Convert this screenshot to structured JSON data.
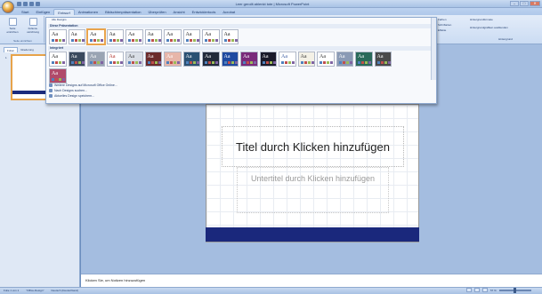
{
  "window": {
    "title": "Leer gerollt ablenkt tote | Microsoft PowerPoint",
    "controls": [
      "–",
      "□",
      "✕"
    ]
  },
  "quick_access": [
    "save-icon",
    "undo-icon",
    "redo-icon",
    "dropdown-icon"
  ],
  "tabs": [
    {
      "label": "Start",
      "active": false
    },
    {
      "label": "Einfügen",
      "active": false
    },
    {
      "label": "Entwurf",
      "active": true
    },
    {
      "label": "Animationen",
      "active": false
    },
    {
      "label": "Bildschirmpräsentation",
      "active": false
    },
    {
      "label": "Überprüfen",
      "active": false
    },
    {
      "label": "Ansicht",
      "active": false
    },
    {
      "label": "Entwicklertools",
      "active": false
    },
    {
      "label": "Acrobat",
      "active": false
    }
  ],
  "ribbon": {
    "page_setup_group": {
      "buttons": [
        "Seite einrichten",
        "Foliena­usrichtung"
      ],
      "label": "Seite einrichten"
    },
    "right_group": {
      "buttons": [
        "Farben",
        "Schriftarten",
        "Effekte"
      ],
      "bg_buttons": [
        "Hintergrundformate",
        "Hintergrundgrafiken ausblenden"
      ],
      "label": "Hintergrund"
    }
  },
  "gallery": {
    "top_button": "Alle Designs",
    "section_this": "Diese Präsentation",
    "section_builtin": "Integriert",
    "menu_items": [
      {
        "icon": "globe-icon",
        "label": "Weitere Designs auf Microsoft Office Online..."
      },
      {
        "icon": "folder-icon",
        "label": "Nach Designs suchen..."
      },
      {
        "icon": "save-icon",
        "label": "Aktuelles Design speichern..."
      }
    ],
    "row1": [
      {
        "name": "design-1",
        "bg": "#ffffff",
        "fg": "#222222",
        "selected": false
      },
      {
        "name": "design-2",
        "bg": "#ffffff",
        "fg": "#222222",
        "selected": false
      },
      {
        "name": "design-3",
        "bg": "#ffffff",
        "fg": "#222222",
        "selected": true
      },
      {
        "name": "design-4",
        "bg": "#ffffff",
        "fg": "#222222",
        "selected": false
      },
      {
        "name": "design-5",
        "bg": "#ffffff",
        "fg": "#222222",
        "selected": false
      },
      {
        "name": "design-6",
        "bg": "#ffffff",
        "fg": "#222222",
        "selected": false
      },
      {
        "name": "design-7",
        "bg": "#ffffff",
        "fg": "#222222",
        "selected": false
      },
      {
        "name": "design-8",
        "bg": "#ffffff",
        "fg": "#222222",
        "selected": false
      },
      {
        "name": "design-9",
        "bg": "#ffffff",
        "fg": "#222222",
        "selected": false
      },
      {
        "name": "design-10",
        "bg": "#ffffff",
        "fg": "#222222",
        "selected": false
      }
    ],
    "row2": [
      {
        "name": "builtin-1",
        "bg": "#ffffff",
        "fg": "#222222"
      },
      {
        "name": "builtin-2",
        "bg": "#3b4a5e",
        "fg": "#ffffff"
      },
      {
        "name": "builtin-3",
        "bg": "#9aa4b3",
        "fg": "#ffffff"
      },
      {
        "name": "builtin-4",
        "bg": "#ffffff",
        "fg": "#b0302a"
      },
      {
        "name": "builtin-5",
        "bg": "#d9dee6",
        "fg": "#333333"
      },
      {
        "name": "builtin-6",
        "bg": "#6b2b2b",
        "fg": "#ffffff"
      },
      {
        "name": "builtin-7",
        "bg": "#e7b6a9",
        "fg": "#ffffff"
      },
      {
        "name": "builtin-8",
        "bg": "#2b5173",
        "fg": "#ffffff"
      },
      {
        "name": "builtin-9",
        "bg": "#222a3a",
        "fg": "#ffffff"
      },
      {
        "name": "builtin-10",
        "bg": "#1f4aa0",
        "fg": "#ffffff"
      },
      {
        "name": "builtin-11",
        "bg": "#7a2a7a",
        "fg": "#ffffff"
      },
      {
        "name": "builtin-12",
        "bg": "#1a1a2a",
        "fg": "#ffffff"
      },
      {
        "name": "builtin-13",
        "bg": "#ffffff",
        "fg": "#3a5aa0"
      },
      {
        "name": "builtin-14",
        "bg": "#f4f1e6",
        "fg": "#333333"
      },
      {
        "name": "builtin-15",
        "bg": "#ffffff",
        "fg": "#333333"
      },
      {
        "name": "builtin-16",
        "bg": "#8a9ab5",
        "fg": "#ffffff"
      },
      {
        "name": "builtin-17",
        "bg": "#2a6a5a",
        "fg": "#ffffff"
      },
      {
        "name": "builtin-18",
        "bg": "#4a4a4a",
        "fg": "#ffffff"
      },
      {
        "name": "builtin-19",
        "bg": "#b04a6a",
        "fg": "#ffffff"
      }
    ],
    "theme_glyph": "Aa"
  },
  "left_pane": {
    "tabs": [
      "Folien",
      "Gliederung"
    ],
    "close": "×",
    "slide_number": "1"
  },
  "slide": {
    "title_placeholder": "Titel durch Klicken hinzufügen",
    "subtitle_placeholder": "Untertitel durch Klicken hinzufügen",
    "band_color": "#1a287c"
  },
  "notes": {
    "placeholder": "Klicken Sie, um Notizen hinzuzufügen"
  },
  "status": {
    "slide_info": "Folie 1 von 1",
    "theme_name": "\"Office-Design\"",
    "language": "Deutsch (Deutschland)",
    "zoom": "57 %"
  }
}
